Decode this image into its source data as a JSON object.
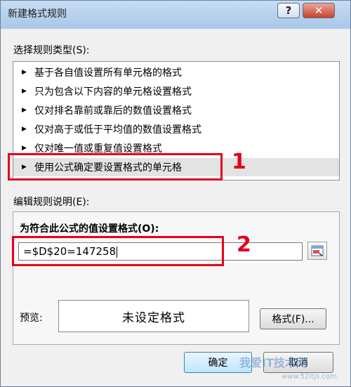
{
  "window": {
    "title": "新建格式规则",
    "help_glyph": "?",
    "close_glyph": "✕"
  },
  "rule_type": {
    "label": "选择规则类型(S):",
    "items": [
      "基于各自值设置所有单元格的格式",
      "只为包含以下内容的单元格设置格式",
      "仅对排名靠前或靠后的数值设置格式",
      "仅对高于或低于平均值的数值设置格式",
      "仅对唯一值或重复值设置格式",
      "使用公式确定要设置格式的单元格"
    ],
    "selected_index": 5
  },
  "edit": {
    "label": "编辑规则说明(E):",
    "formula_label": "为符合此公式的值设置格式(O):",
    "formula_value": "=$D$20=147258"
  },
  "preview": {
    "label": "预览:",
    "text": "未设定格式"
  },
  "buttons": {
    "format": "格式(F)...",
    "ok": "确定",
    "cancel": "取消"
  },
  "annotations": {
    "one": "1",
    "two": "2"
  },
  "watermark": {
    "main": "我爱IT技术网",
    "sub": "www.52itjs.com"
  },
  "colors": {
    "annotation_red": "#e3001b",
    "title_bar": "#b9d1ea",
    "selected_row": "#e3e3e3"
  }
}
